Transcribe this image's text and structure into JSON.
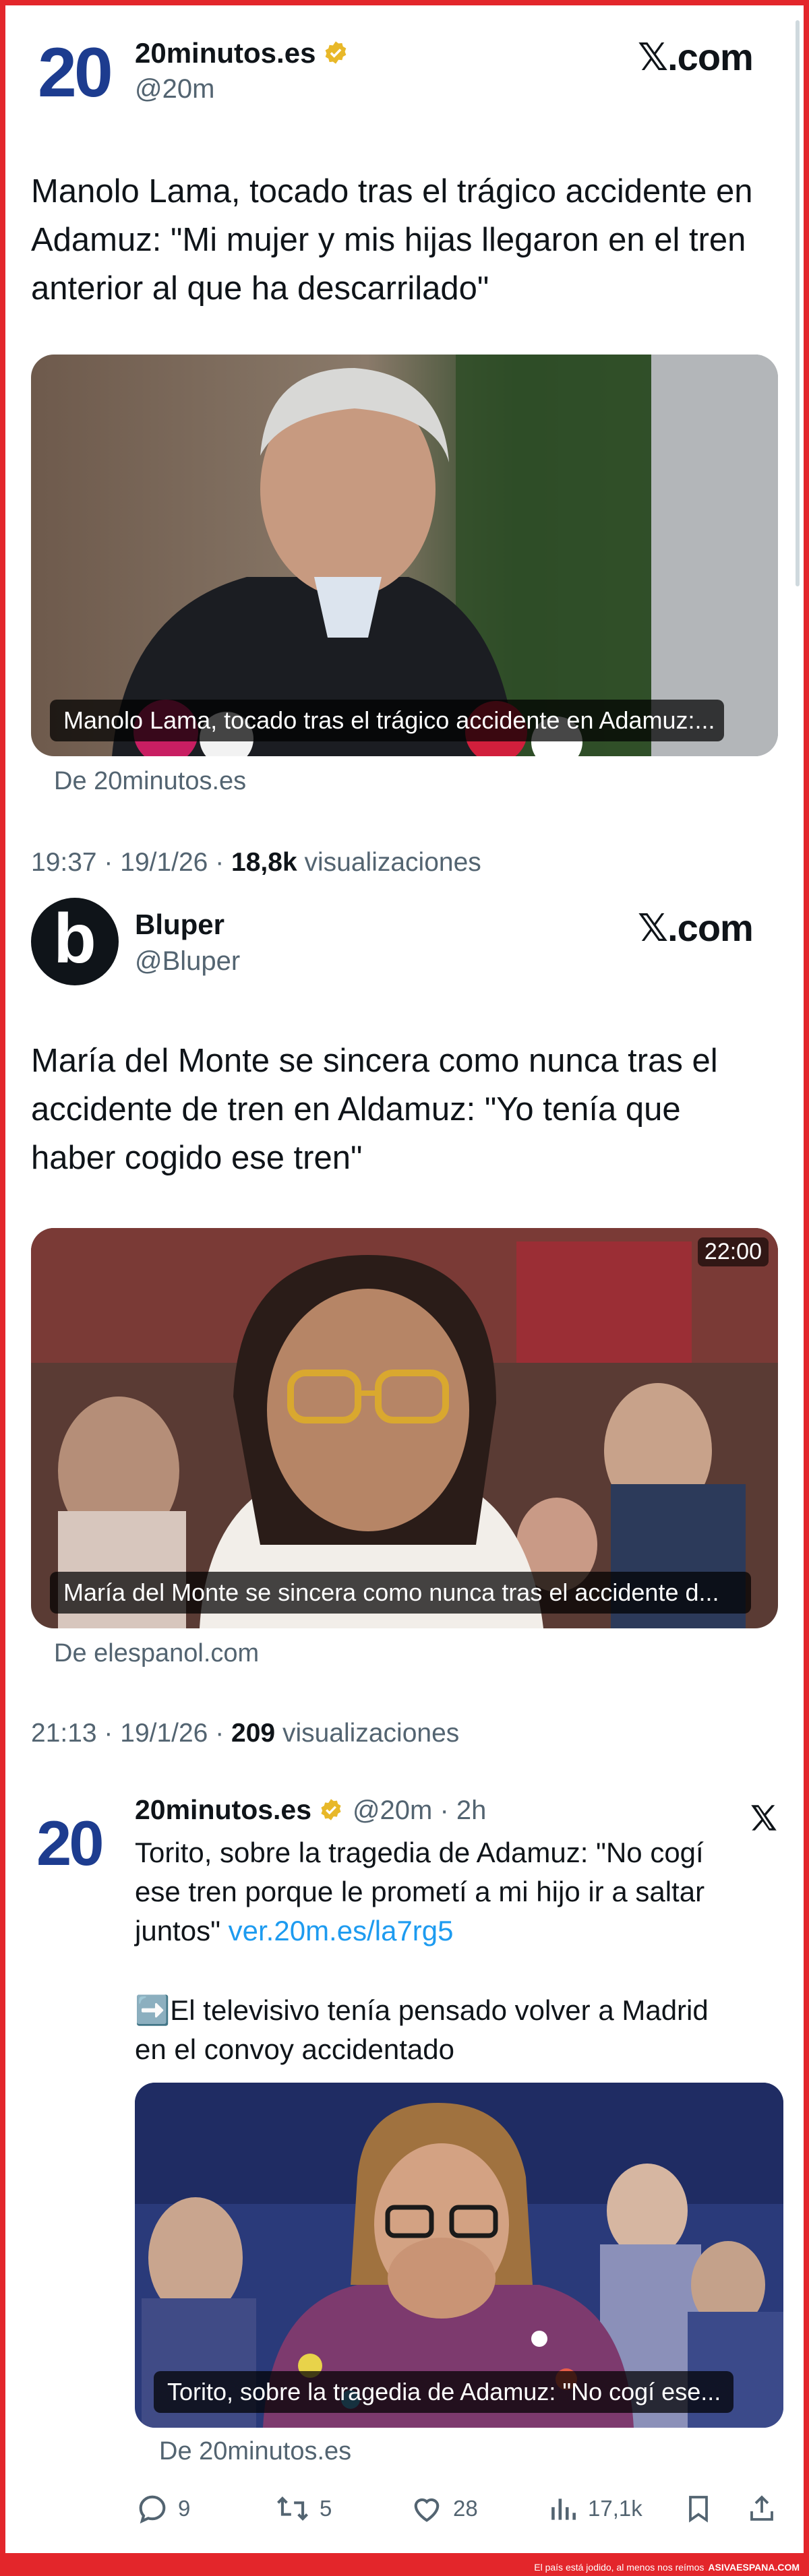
{
  "post1": {
    "logo_text": "20",
    "name": "20minutos.es",
    "handle": "@20m",
    "site": "𝕏.com",
    "text_lines": [
      "Manolo Lama, tocado tras el trágico accidente en",
      "Adamuz: \"Mi mujer y mis hijas llegaron en el tren",
      "anterior al que ha descarrilado\""
    ],
    "media_caption": "Manolo Lama, tocado tras el trágico accidente en Adamuz:...",
    "source": "De 20minutos.es",
    "time": "19:37 · 19/1/26 · ",
    "views_count": "18,8k",
    "views_label": " visualizaciones"
  },
  "post2": {
    "logo_text": "b",
    "name": "Bluper",
    "handle": "@Bluper",
    "site": "𝕏.com",
    "text_lines": [
      "María del Monte se sincera como nunca tras el",
      "accidente de tren en Aldamuz: \"Yo tenía que",
      "haber cogido ese tren\""
    ],
    "video_duration": "22:00",
    "media_caption": "María del Monte se sincera como nunca tras el accidente d...",
    "source": "De elespanol.com",
    "time": "21:13 · 19/1/26 · ",
    "views_count": "209",
    "views_label": " visualizaciones"
  },
  "post3": {
    "logo_text": "20",
    "name": "20minutos.es",
    "handle_time": "@20m · 2h",
    "text_lines": [
      "Torito, sobre la tragedia de Adamuz: \"No cogí",
      "ese tren porque le prometí a mi hijo ir a saltar"
    ],
    "text_line3": "juntos\" ",
    "link": "ver.20m.es/la7rg5",
    "text2_lines": [
      "➡️El televisivo tenía pensado volver a Madrid",
      "en el convoy accidentado"
    ],
    "media_caption": "Torito, sobre la tragedia de Adamuz: \"No cogí ese...",
    "source": "De 20minutos.es",
    "actions": {
      "replies": "9",
      "reposts": "5",
      "likes": "28",
      "views": "17,1k"
    }
  },
  "footer": {
    "text": "El país está jodido, al menos nos reímos",
    "brand": "ASIVAESPANA.COM"
  },
  "colors": {
    "frame_red": "#e3262b",
    "brand_blue": "#1d3c8f",
    "verified_gold": "#e8b829",
    "link_blue": "#1d9bf0",
    "muted": "#536471"
  }
}
